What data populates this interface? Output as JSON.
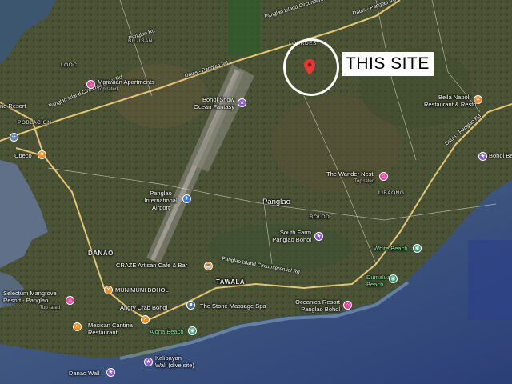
{
  "site": {
    "label": "THIS SITE"
  },
  "areas": {
    "bil_isan": "BIL-ISAN",
    "looc": "LOOC",
    "poblacion": "POBLACION",
    "lourdes": "LOURDES",
    "libaong": "LIBAONG",
    "bolod": "BOLOD",
    "danao": "DANAO",
    "tawala": "TAWALA",
    "panglao": "Panglao"
  },
  "roads": {
    "r1": "Panglao Island Circumferential Rd",
    "r2": "Dauis - Panglao Rd",
    "r3": "Panglao Rd",
    "r4": "Dauis - Panglao Rd",
    "r5": "Panglao Island Circumferential Rd",
    "r6": "Panglao Island Circumferential Rd",
    "r7": "Dauis - Panglao Rd"
  },
  "places": {
    "moravian": {
      "name": "Moravian Apartments",
      "sub": "Top rated"
    },
    "bohol_show": {
      "name": "Bohol Show\nOcean Fantasy"
    },
    "bella_napoli": {
      "name": "Bella Napoli\nRestaurant & Resto"
    },
    "ne_resort": {
      "name": "ne Resort"
    },
    "ubeco": {
      "name": "Ubeco"
    },
    "bohol_bee": {
      "name": "Bohol Bee F"
    },
    "wander_nest": {
      "name": "The Wander Nest",
      "sub": "Top rated"
    },
    "airport": {
      "name": "Panglao\nInternational\nAirport"
    },
    "south_farm": {
      "name": "South Farm\nPanglao Bohol"
    },
    "white_beach": {
      "name": "White Beach"
    },
    "craze": {
      "name": "CRAZE Artisan Cafe & Bar"
    },
    "munimuni": {
      "name": "MUNIMUNI BOHOL"
    },
    "dumaluan": {
      "name": "Dumaluan\nBeach"
    },
    "selectum": {
      "name": "Selectum Mangrove\nResort - Panglao",
      "sub": "Top rated"
    },
    "angry_crab": {
      "name": "Angry Crab Bohol"
    },
    "stone_massage": {
      "name": "The Stone Massage Spa"
    },
    "oceanica": {
      "name": "Oceanica Resort\nPanglao Bohol"
    },
    "mexican": {
      "name": "Mexican Cantina\nRestaurant"
    },
    "alona": {
      "name": "Alona Beach"
    },
    "kalipayan": {
      "name": "Kalipayan\nWall (dive site)"
    },
    "danao_wall": {
      "name": "Danao Wall"
    }
  }
}
